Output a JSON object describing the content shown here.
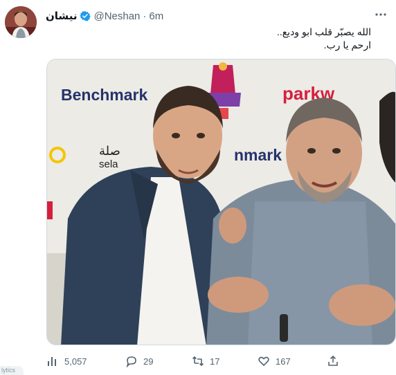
{
  "tweet": {
    "author_name": "نيشان",
    "handle": "@Neshan",
    "separator": "·",
    "time": "6m",
    "text_lines": [
      "الله يصبّر قلب ابو وديع..",
      "ارحم يا رب."
    ]
  },
  "media": {
    "backdrop_logos": [
      "Benchmark",
      "parkw",
      "صلة",
      "sela",
      "nmark"
    ]
  },
  "actions": {
    "views": "5,057",
    "replies": "29",
    "retweets": "17",
    "likes": "167"
  },
  "side_tab": {
    "label": "lytics"
  },
  "colors": {
    "verified": "#1d9bf0",
    "muted": "#536471",
    "accent_red": "#d61f3d"
  },
  "icons": [
    "verified-badge-icon",
    "more-icon",
    "analytics-icon",
    "reply-icon",
    "retweet-icon",
    "like-icon",
    "share-icon"
  ]
}
